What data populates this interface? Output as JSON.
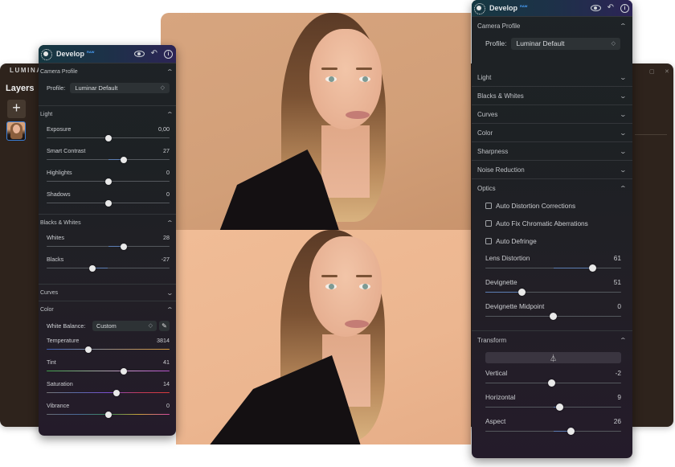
{
  "app": {
    "logo": "LUMINAR",
    "layers_title": "Layers",
    "add_layer_symbol": "+",
    "window_controls": [
      "▢",
      "✕"
    ]
  },
  "icons": {
    "develop": "sun-icon",
    "preview": "eye-icon",
    "undo": "undo-icon",
    "info": "info-icon",
    "chevron_up": "⌃",
    "chevron_down": "⌄",
    "select_arrows": "⇕",
    "eyedropper": "✎",
    "perspective": "⏃"
  },
  "left_panel": {
    "title": "Develop",
    "badge": "RAW",
    "camera_profile": {
      "title": "Camera Profile",
      "profile_label": "Profile:",
      "profile_value": "Luminar Default"
    },
    "light": {
      "title": "Light",
      "sliders": [
        {
          "label": "Exposure",
          "value": "0,00",
          "position": 0.5,
          "fill_from": 0.5
        },
        {
          "label": "Smart Contrast",
          "value": "27",
          "position": 0.63,
          "fill_from": 0.5
        },
        {
          "label": "Highlights",
          "value": "0",
          "position": 0.5,
          "fill_from": 0.5
        },
        {
          "label": "Shadows",
          "value": "0",
          "position": 0.5,
          "fill_from": 0.5
        }
      ]
    },
    "blacks_whites": {
      "title": "Blacks & Whites",
      "sliders": [
        {
          "label": "Whites",
          "value": "28",
          "position": 0.63,
          "fill_from": 0.5
        },
        {
          "label": "Blacks",
          "value": "-27",
          "position": 0.37,
          "fill_from": 0.5
        }
      ]
    },
    "curves": {
      "title": "Curves"
    },
    "color": {
      "title": "Color",
      "white_balance_label": "White Balance:",
      "white_balance_value": "Custom",
      "sliders": [
        {
          "label": "Temperature",
          "value": "3814",
          "position": 0.34,
          "gradient": "linear-gradient(90deg,#3e5fb8,#7d8aa0,#b09068,#d99a3a)"
        },
        {
          "label": "Tint",
          "value": "41",
          "position": 0.63,
          "gradient": "linear-gradient(90deg,#3da04a,#8fa88f,#c590c8,#b34fc9)"
        },
        {
          "label": "Saturation",
          "value": "14",
          "position": 0.57,
          "gradient": "linear-gradient(90deg,#777,#5a6aa8,#7a4fd0,#c33a5a,#d93a3a)"
        },
        {
          "label": "Vibrance",
          "value": "0",
          "position": 0.5,
          "gradient": "linear-gradient(90deg,#6a6e73,#4a6a9a,#3a8a5a,#c9a23a,#d64aa0)"
        }
      ]
    }
  },
  "right_panel": {
    "title": "Develop",
    "badge": "RAW",
    "camera_profile": {
      "title": "Camera Profile",
      "profile_label": "Profile:",
      "profile_value": "Luminar Default"
    },
    "collapsed_sections": [
      "Light",
      "Blacks & Whites",
      "Curves",
      "Color",
      "Sharpness",
      "Noise Reduction"
    ],
    "optics": {
      "title": "Optics",
      "checkboxes": [
        {
          "label": "Auto Distortion Corrections",
          "checked": false
        },
        {
          "label": "Auto Fix Chromatic Aberrations",
          "checked": false
        },
        {
          "label": "Auto Defringe",
          "checked": false
        }
      ],
      "sliders": [
        {
          "label": "Lens Distortion",
          "value": "61",
          "position": 0.79,
          "fill_from": 0.5
        },
        {
          "label": "Devignette",
          "value": "51",
          "position": 0.27,
          "fill_from": 0.0
        },
        {
          "label": "Devignette Midpoint",
          "value": "0",
          "position": 0.5,
          "fill_from": 0.5
        }
      ]
    },
    "transform": {
      "title": "Transform",
      "sliders": [
        {
          "label": "Vertical",
          "value": "-2",
          "position": 0.49,
          "fill_from": 0.5
        },
        {
          "label": "Horizontal",
          "value": "9",
          "position": 0.55,
          "fill_from": 0.5
        },
        {
          "label": "Aspect",
          "value": "26",
          "position": 0.63,
          "fill_from": 0.5
        }
      ]
    }
  }
}
